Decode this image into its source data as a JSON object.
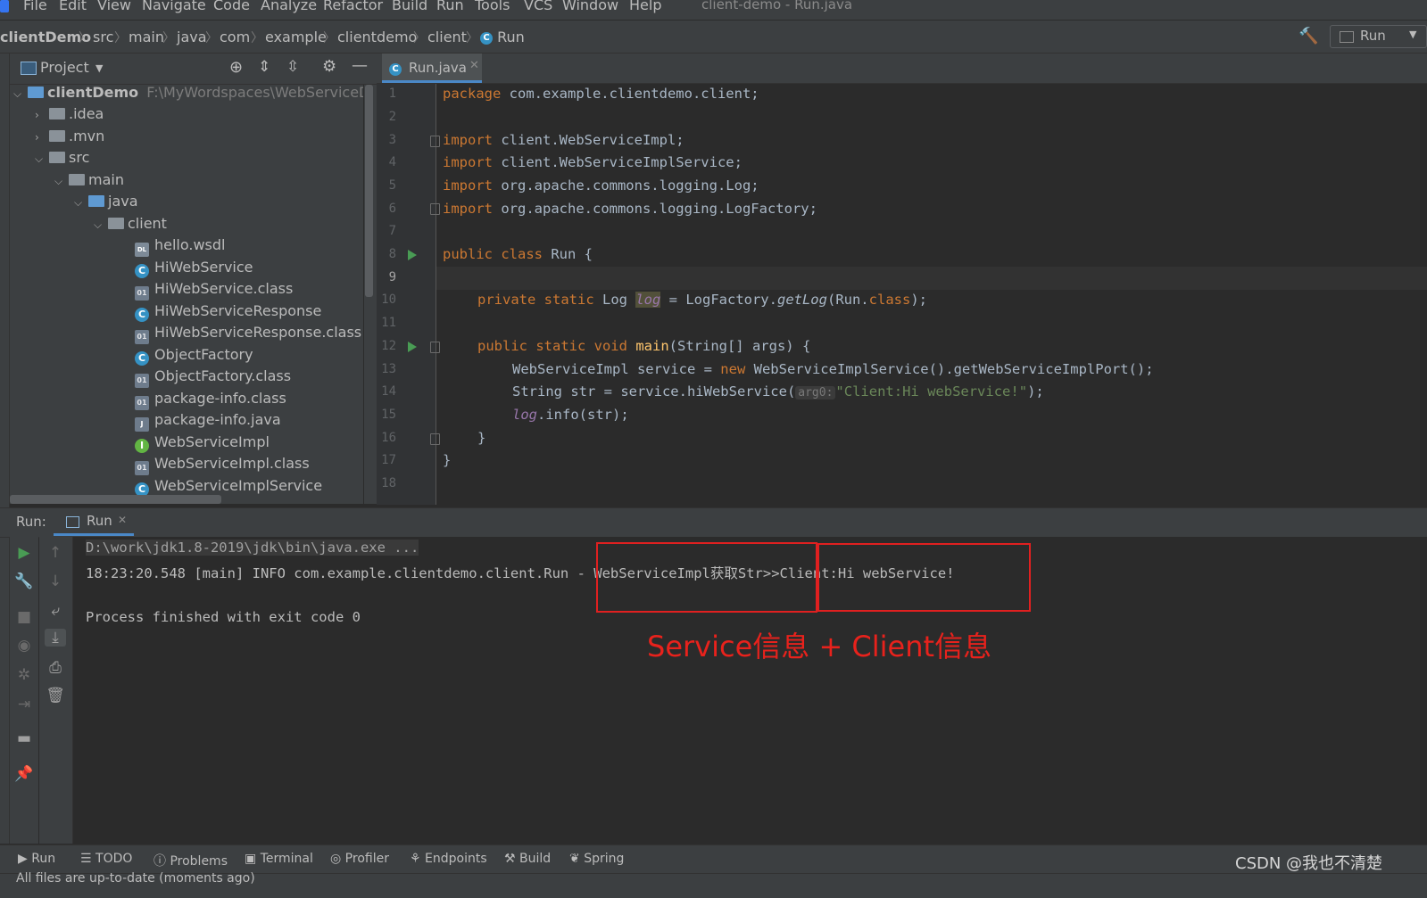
{
  "menu": {
    "items": [
      "File",
      "Edit",
      "View",
      "Navigate",
      "Code",
      "Analyze",
      "Refactor",
      "Build",
      "Run",
      "Tools",
      "VCS",
      "Window",
      "Help"
    ],
    "window_title": "client-demo - Run.java"
  },
  "breadcrumb": [
    "clientDemo",
    "src",
    "main",
    "java",
    "com",
    "example",
    "clientdemo",
    "client",
    "Run"
  ],
  "run_config": "Run",
  "project_panel": {
    "title": "Project",
    "root_name": "clientDemo",
    "root_path": "F:\\MyWordspaces\\WebServiceDemo",
    "tree": [
      {
        "label": ".idea",
        "kind": "folder"
      },
      {
        "label": ".mvn",
        "kind": "folder"
      },
      {
        "label": "src",
        "kind": "folder"
      },
      {
        "label": "main",
        "kind": "folder"
      },
      {
        "label": "java",
        "kind": "folder-blue"
      },
      {
        "label": "client",
        "kind": "package"
      },
      {
        "label": "hello.wsdl",
        "kind": "wsdl"
      },
      {
        "label": "HiWebService",
        "kind": "class"
      },
      {
        "label": "HiWebService.class",
        "kind": "binary"
      },
      {
        "label": "HiWebServiceResponse",
        "kind": "class"
      },
      {
        "label": "HiWebServiceResponse.class",
        "kind": "binary"
      },
      {
        "label": "ObjectFactory",
        "kind": "class"
      },
      {
        "label": "ObjectFactory.class",
        "kind": "binary"
      },
      {
        "label": "package-info.class",
        "kind": "binary"
      },
      {
        "label": "package-info.java",
        "kind": "java"
      },
      {
        "label": "WebServiceImpl",
        "kind": "interface"
      },
      {
        "label": "WebServiceImpl.class",
        "kind": "binary"
      },
      {
        "label": "WebServiceImplService",
        "kind": "class"
      }
    ]
  },
  "editor": {
    "tab": "Run.java",
    "current_line": 9,
    "line_numbers": [
      "1",
      "2",
      "3",
      "4",
      "5",
      "6",
      "7",
      "8",
      "9",
      "10",
      "11",
      "12",
      "13",
      "14",
      "15",
      "16",
      "17",
      "18"
    ],
    "code": {
      "l1_kw": "package",
      "l1_rest": " com.example.clientdemo.client;",
      "l3_kw": "import",
      "l3_rest": " client.WebServiceImpl;",
      "l4_kw": "import",
      "l4_rest": " client.WebServiceImplService;",
      "l5_kw": "import",
      "l5_rest": " org.apache.commons.logging.Log;",
      "l6_kw": "import",
      "l6_rest": " org.apache.commons.logging.LogFactory;",
      "l8_kw": "public class",
      "l8_rest": " Run {",
      "l10_kw": "private static",
      "l10_type": " Log ",
      "l10_var": "log",
      "l10_mid": " = LogFactory.",
      "l10_call": "getLog",
      "l10_args": "(Run.",
      "l10_cls": "class",
      "l10_end": ");",
      "l12_kw": "public static void",
      "l12_fn": "main",
      "l12_rest": "(String[] args) {",
      "l13_a": "WebServiceImpl service = ",
      "l13_kw": "new",
      "l13_b": " WebServiceImplService().getWebServiceImplPort();",
      "l14_a": "String str = service.hiWebService(",
      "l14_hint": "arg0:",
      "l14_str": "\"Client:Hi webService!\"",
      "l14_end": ");",
      "l15_var": "log",
      "l15_rest": ".info(str);",
      "l16": "}",
      "l17": "}"
    }
  },
  "run_panel": {
    "label": "Run:",
    "tab": "Run",
    "console": [
      "D:\\work\\jdk1.8-2019\\jdk\\bin\\java.exe ...",
      "18:23:20.548 [main] INFO com.example.clientdemo.client.Run - WebServiceImpl获取Str>>Client:Hi webService!",
      "",
      "Process finished with exit code 0"
    ]
  },
  "annotation": {
    "text": "Service信息 + Client信息",
    "color": "#e8221c"
  },
  "bottom_tabs": [
    "Run",
    "TODO",
    "Problems",
    "Terminal",
    "Profiler",
    "Endpoints",
    "Build",
    "Spring"
  ],
  "status": "All files are up-to-date (moments ago)",
  "watermark": "CSDN @我也不清楚",
  "colors": {
    "keyword": "#cc7832",
    "string": "#6a8759",
    "method": "#ffc66d",
    "field": "#9876aa",
    "accent": "#4a88c7"
  }
}
